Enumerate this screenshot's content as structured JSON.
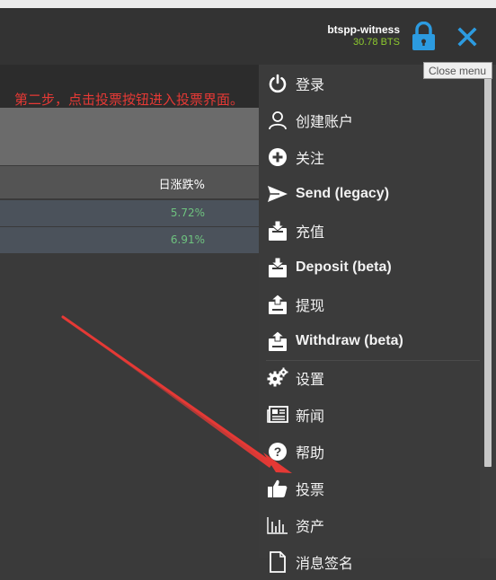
{
  "header": {
    "account_name": "btspp-witness",
    "account_balance": "30.78 BTS",
    "lock_icon": "lock-icon",
    "close_icon": "close-icon",
    "accent_blue": "#2c9be0",
    "balance_green": "#8ecb2f"
  },
  "tooltip": {
    "text": "Close menu"
  },
  "banner": {
    "text": "第二步，点击投票按钮进入投票界面。",
    "color": "#e53935"
  },
  "table": {
    "header": "日涨跌%",
    "rows": [
      "5.72%",
      "6.91%"
    ]
  },
  "menu": {
    "items": [
      {
        "label": "登录",
        "icon": "power-icon"
      },
      {
        "label": "创建账户",
        "icon": "user-icon"
      },
      {
        "label": "关注",
        "icon": "plus-circle-icon"
      },
      {
        "label": "Send (legacy)",
        "icon": "send-icon"
      },
      {
        "label": "充值",
        "icon": "deposit-icon"
      },
      {
        "label": "Deposit (beta)",
        "icon": "deposit-icon"
      },
      {
        "label": "提现",
        "icon": "withdraw-icon"
      },
      {
        "label": "Withdraw (beta)",
        "icon": "withdraw-icon"
      },
      {
        "label": "设置",
        "icon": "gears-icon"
      },
      {
        "label": "新闻",
        "icon": "newspaper-icon"
      },
      {
        "label": "帮助",
        "icon": "help-icon"
      },
      {
        "label": "投票",
        "icon": "thumbs-up-icon"
      },
      {
        "label": "资产",
        "icon": "bar-chart-icon"
      },
      {
        "label": "消息签名",
        "icon": "document-icon"
      }
    ]
  }
}
